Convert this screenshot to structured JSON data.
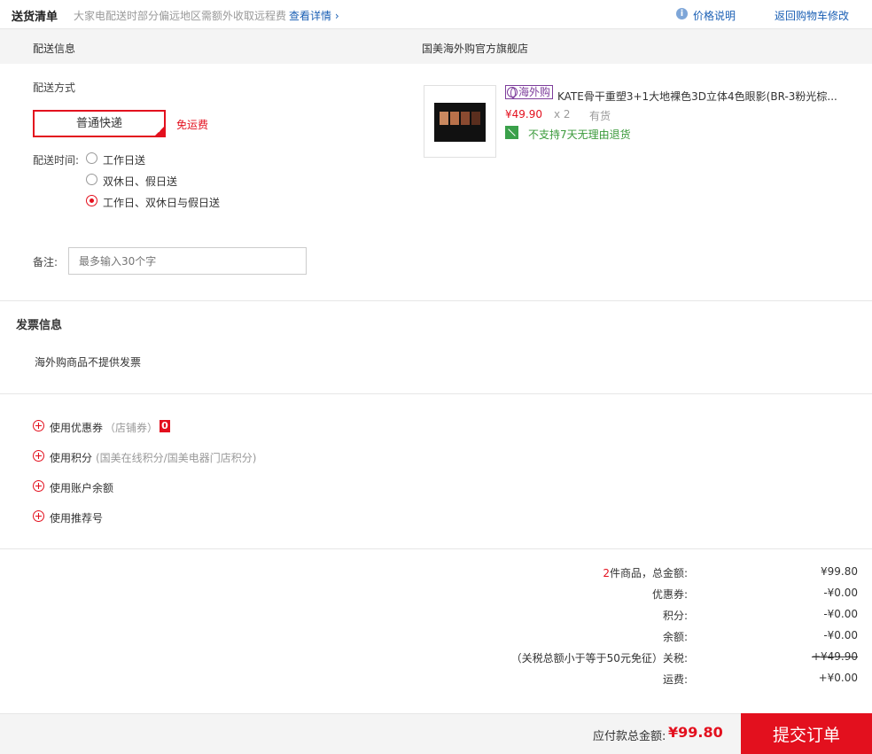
{
  "topbar": {
    "title": "送货清单",
    "notice": "大家电配送时部分偏远地区需额外收取远程费",
    "notice_link": "查看详情 ›",
    "info_icon": "i",
    "price_link": "价格说明",
    "back_link": "返回购物车修改"
  },
  "shipping": {
    "header_left": "配送信息",
    "header_right": "国美海外购官方旗舰店",
    "method_label": "配送方式",
    "method_selected": "普通快递",
    "free_shipping": "免运费",
    "time_label": "配送时间:",
    "time_options": [
      "工作日送",
      "双休日、假日送",
      "工作日、双休日与假日送"
    ],
    "time_selected_index": 2,
    "note_label": "备注:",
    "note_placeholder": "最多输入30个字"
  },
  "product": {
    "tag": "海外购",
    "name": "KATE骨干重塑3+1大地裸色3D立体4色眼影(BR-3粉光棕...",
    "price": "¥49.90",
    "qty": "x 2",
    "stock": "有货",
    "no_return": "不支持7天无理由退货",
    "swatch_colors": [
      "#c9885f",
      "#b9714a",
      "#8a4a30",
      "#5a2e1e"
    ]
  },
  "invoice": {
    "title": "发票信息",
    "text": "海外购商品不提供发票"
  },
  "options": {
    "coupon": "使用优惠券",
    "coupon_sub": "（店铺券）",
    "coupon_count": "0",
    "points": "使用积分",
    "points_sub": "(国美在线积分/国美电器门店积分)",
    "balance": "使用账户余额",
    "referral": "使用推荐号"
  },
  "summary": {
    "count": "2",
    "count_suffix": "件商品，总金额:",
    "total": "¥99.80",
    "coupon_label": "优惠券:",
    "coupon_value": "-¥0.00",
    "points_label": "积分:",
    "points_value": "-¥0.00",
    "balance_label": "余额:",
    "balance_value": "-¥0.00",
    "tax_label": "（关税总额小于等于50元免征）关税:",
    "tax_value": "+¥49.90",
    "shipping_label": "运费:",
    "shipping_value": "+¥0.00"
  },
  "footer": {
    "total_label": "应付款总金额:",
    "total_value": "¥99.80",
    "submit": "提交订单"
  },
  "colors": {
    "accent": "#e3101e",
    "link": "#1a5fb4",
    "overseas": "#7d3d9b",
    "green": "#3a9a3a"
  }
}
